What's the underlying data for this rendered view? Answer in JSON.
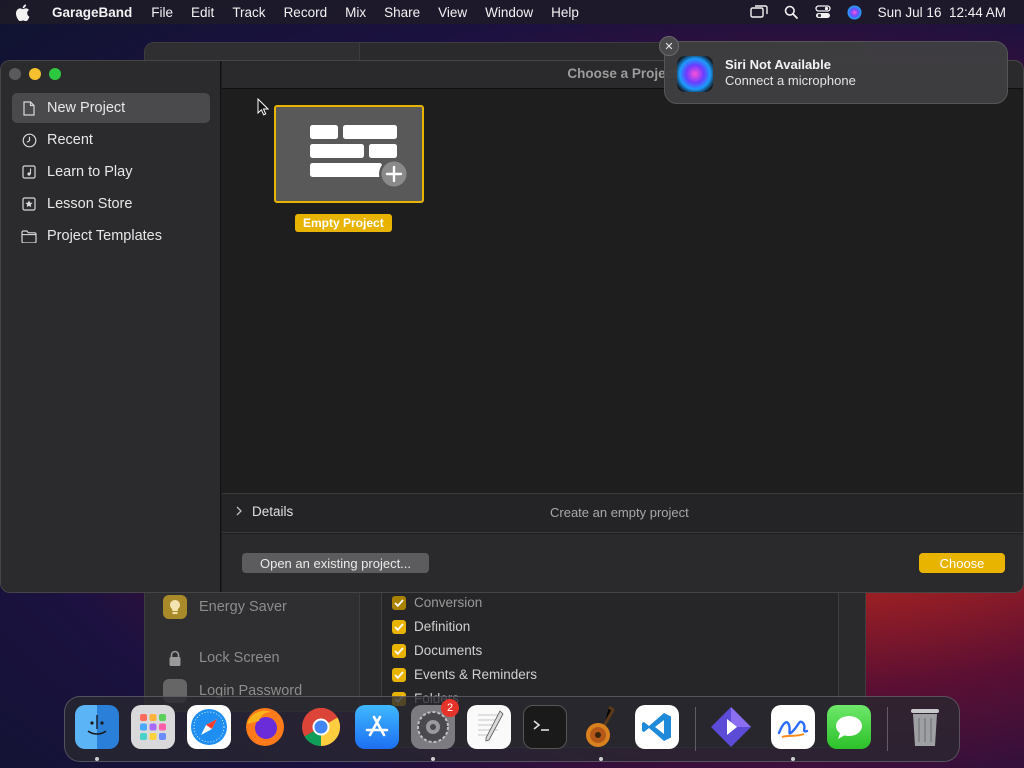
{
  "menubar": {
    "app_name": "GarageBand",
    "menus": [
      "File",
      "Edit",
      "Track",
      "Record",
      "Mix",
      "Share",
      "View",
      "Window",
      "Help"
    ],
    "datetime": "Sun Jul 16  12:44 AM",
    "status_icons": [
      "screen-mirroring-icon",
      "spotlight-search-icon",
      "control-center-icon",
      "siri-icon"
    ]
  },
  "background_window": {
    "sidebar_items": [
      {
        "label": "Energy Saver",
        "icon": "energy-saver-icon"
      },
      {
        "label": "Lock Screen",
        "icon": "lock-icon"
      },
      {
        "label": "Login Password",
        "icon": "login-password-icon"
      }
    ],
    "checklist": [
      {
        "label": "Conversion",
        "checked": true
      },
      {
        "label": "Definition",
        "checked": true
      },
      {
        "label": "Documents",
        "checked": true
      },
      {
        "label": "Events & Reminders",
        "checked": true
      },
      {
        "label": "Folders",
        "checked": true
      }
    ]
  },
  "garageband": {
    "window_title": "Choose a Project",
    "sidebar": {
      "items": [
        {
          "label": "New Project",
          "icon": "document-icon",
          "selected": true
        },
        {
          "label": "Recent",
          "icon": "clock-icon",
          "selected": false
        },
        {
          "label": "Learn to Play",
          "icon": "music-note-icon",
          "selected": false
        },
        {
          "label": "Lesson Store",
          "icon": "star-icon",
          "selected": false
        },
        {
          "label": "Project Templates",
          "icon": "folder-icon",
          "selected": false
        }
      ]
    },
    "templates": [
      {
        "label": "Empty Project",
        "selected": true
      }
    ],
    "details": {
      "toggle_label": "Details",
      "description": "Create an empty project"
    },
    "buttons": {
      "open_existing": "Open an existing project...",
      "choose": "Choose"
    }
  },
  "notification": {
    "title": "Siri Not Available",
    "body": "Connect a microphone"
  },
  "dock": {
    "items": [
      {
        "name": "Finder",
        "running": true
      },
      {
        "name": "Launchpad",
        "running": false
      },
      {
        "name": "Safari",
        "running": false
      },
      {
        "name": "Firefox",
        "running": false
      },
      {
        "name": "Chrome",
        "running": false
      },
      {
        "name": "App Store",
        "running": false
      },
      {
        "name": "System Settings",
        "running": true,
        "badge": "2"
      },
      {
        "name": "TextEdit",
        "running": false
      },
      {
        "name": "Terminal",
        "running": false
      },
      {
        "name": "GarageBand",
        "running": true
      },
      {
        "name": "Visual Studio Code",
        "running": false
      },
      {
        "name": "Shortcuts",
        "running": false
      },
      {
        "name": "Freeform",
        "running": true
      },
      {
        "name": "Messages",
        "running": false
      },
      {
        "name": "Trash",
        "running": false
      }
    ]
  },
  "colors": {
    "accent": "#e8b400",
    "sidebar_selected": "#4a4a4d",
    "window_bg": "#1e1e1e"
  }
}
